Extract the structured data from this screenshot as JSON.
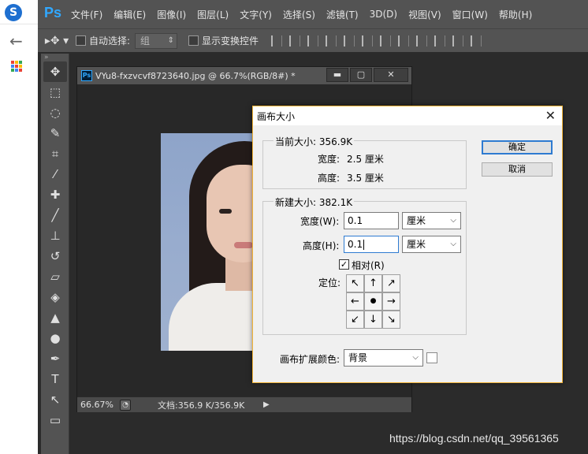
{
  "menubar": {
    "logo": "Ps",
    "items": [
      "文件(F)",
      "编辑(E)",
      "图像(I)",
      "图层(L)",
      "文字(Y)",
      "选择(S)",
      "滤镜(T)",
      "3D(D)",
      "视图(V)",
      "窗口(W)",
      "帮助(H)"
    ]
  },
  "options": {
    "auto_select_label": "自动选择:",
    "group_select_value": "组",
    "show_transform_label": "显示变换控件"
  },
  "document": {
    "badge": "Ps",
    "title": "VYu8-fxzvcvf8723640.jpg @ 66.7%(RGB/8#) *",
    "zoom": "66.67%",
    "doc_info": "文档:356.9 K/356.9K"
  },
  "dialog": {
    "title": "画布大小",
    "current_size_label": "当前大小: 356.9K",
    "current_width_label": "宽度:",
    "current_width_value": "2.5 厘米",
    "current_height_label": "高度:",
    "current_height_value": "3.5 厘米",
    "new_size_label": "新建大小: 382.1K",
    "width_label": "宽度(W):",
    "width_value": "0.1",
    "width_unit": "厘米",
    "height_label": "高度(H):",
    "height_value": "0.1",
    "height_unit": "厘米",
    "relative_label": "相对(R)",
    "relative_checked": true,
    "anchor_label": "定位:",
    "anchor_glyphs": [
      "↖",
      "↑",
      "↗",
      "←",
      "●",
      "→",
      "↙",
      "↓",
      "↘"
    ],
    "extension_color_label": "画布扩展颜色:",
    "extension_color_value": "背景",
    "ok_label": "确定",
    "cancel_label": "取消"
  },
  "watermark": "https://blog.csdn.net/qq_39561365"
}
